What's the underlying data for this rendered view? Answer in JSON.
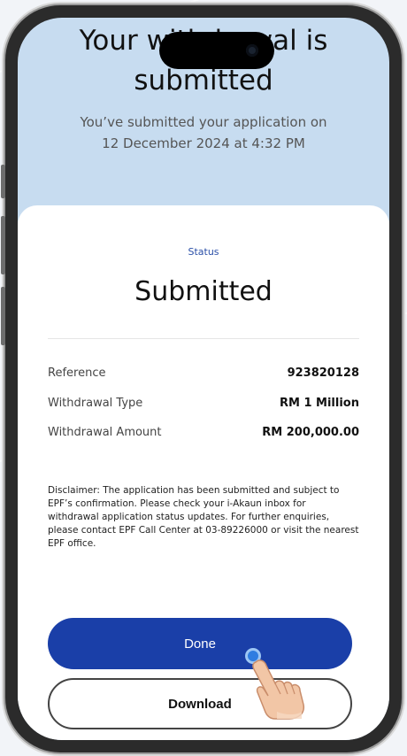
{
  "header": {
    "title_line1": "Your withdrawal is",
    "title_line2": "submitted",
    "subtitle_line1": "You’ve submitted your application on",
    "subtitle_line2": "12 December 2024 at 4:32 PM"
  },
  "status": {
    "label": "Status",
    "value": "Submitted"
  },
  "details": [
    {
      "label": "Reference",
      "value": "923820128"
    },
    {
      "label": "Withdrawal Type",
      "value": "RM 1 Million"
    },
    {
      "label": "Withdrawal Amount",
      "value": "RM 200,000.00"
    }
  ],
  "disclaimer": "Disclaimer: The application has been submitted and subject to EPF’s confirmation. Please check your i-Akaun inbox for withdrawal application status updates. For further enquiries, please contact EPF Call Center at 03-89226000 or visit the nearest EPF office.",
  "buttons": {
    "done": "Done",
    "download": "Download"
  },
  "colors": {
    "accent": "#1a3fa8",
    "header_bg": "#c7dcf0"
  },
  "icons": {
    "tap_indicator": "tap-indicator-icon",
    "hand": "pointing-hand-icon"
  }
}
